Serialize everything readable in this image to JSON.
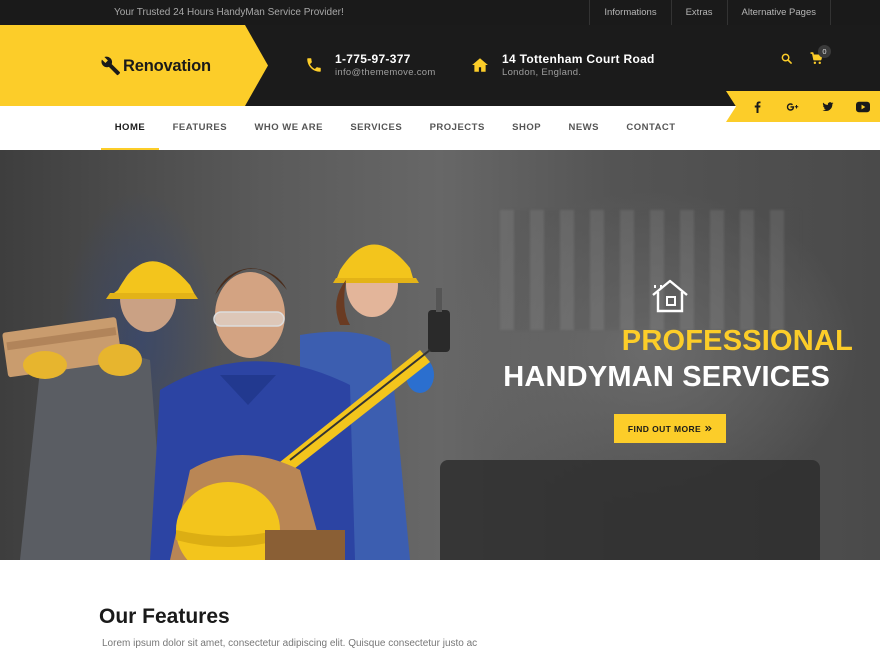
{
  "topbar": {
    "tagline": "Your Trusted 24 Hours HandyMan Service Provider!",
    "links": [
      "Informations",
      "Extras",
      "Alternative Pages"
    ]
  },
  "brand": {
    "name": "Renovation",
    "accent_color": "#fccd29",
    "dark_color": "#1b1b1b",
    "logo_icon": "wrench-icon"
  },
  "header": {
    "phone": {
      "icon": "phone-icon",
      "line1": "1-775-97-377",
      "line2": "info@thememove.com"
    },
    "address": {
      "icon": "home-icon",
      "line1": "14 Tottenham Court Road",
      "line2": "London, England."
    },
    "search_icon": "search-icon",
    "cart": {
      "icon": "cart-icon",
      "count": "0"
    }
  },
  "nav": {
    "items": [
      "HOME",
      "FEATURES",
      "WHO WE ARE",
      "SERVICES",
      "PROJECTS",
      "SHOP",
      "NEWS",
      "CONTACT"
    ],
    "active": "HOME"
  },
  "social": [
    "facebook-icon",
    "google-plus-icon",
    "twitter-icon",
    "youtube-icon"
  ],
  "hero": {
    "icon": "house-tools-icon",
    "title_line1": "PROFESSIONAL",
    "title_line2": "HANDYMAN SERVICES",
    "cta_label": "FIND OUT MORE",
    "cta_icon": "double-chevron-right-icon"
  },
  "features": {
    "heading": "Our Features",
    "text": "Lorem ipsum dolor sit amet, consectetur adipiscing elit. Quisque consectetur justo ac"
  }
}
